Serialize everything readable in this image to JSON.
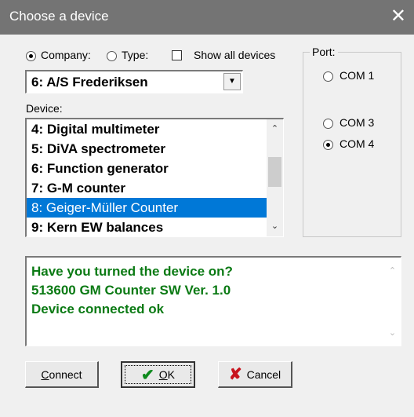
{
  "window": {
    "title": "Choose a device",
    "close_glyph": "✕"
  },
  "filter": {
    "company_label": "Company:",
    "type_label": "Type:",
    "show_all_label": "Show all devices",
    "selected": "company",
    "show_all_checked": false
  },
  "company_select": {
    "value": "6: A/S Frederiksen",
    "arrow": "▼"
  },
  "device": {
    "label": "Device:",
    "items": [
      "4: Digital multimeter",
      "5: DiVA spectrometer",
      "6: Function generator",
      "7: G-M counter",
      "8: Geiger-Müller Counter",
      "9: Kern EW balances"
    ],
    "selected_index": 4,
    "scroll_up": "⌃",
    "scroll_down": "⌄"
  },
  "port": {
    "label": "Port:",
    "options": [
      "COM 1",
      "COM 3",
      "COM 4"
    ],
    "selected": "COM 4"
  },
  "message": {
    "lines": [
      "Have you turned the device on?",
      "513600 GM Counter SW Ver. 1.0",
      "Device connected ok"
    ]
  },
  "buttons": {
    "connect_pre": "",
    "connect_u": "C",
    "connect_post": "onnect",
    "ok_pre": "",
    "ok_u": "O",
    "ok_post": "K",
    "cancel": "Cancel",
    "ok_icon": "✔",
    "cancel_icon": "✘"
  },
  "colors": {
    "selection": "#0078d7",
    "message_text": "#0b7a14",
    "titlebar": "#747474"
  }
}
